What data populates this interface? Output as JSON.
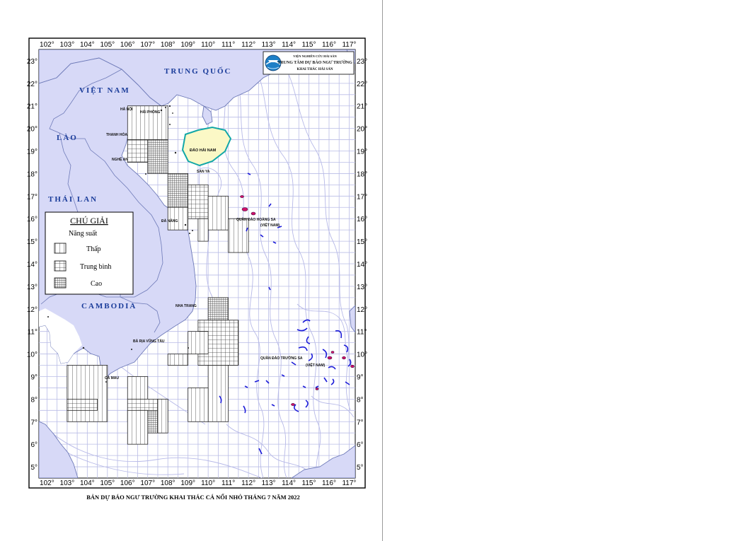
{
  "axes": {
    "lon_labels": [
      "102°",
      "103°",
      "104°",
      "105°",
      "106°",
      "107°",
      "108°",
      "109°",
      "110°",
      "111°",
      "112°",
      "113°",
      "114°",
      "115°",
      "116°",
      "117°"
    ],
    "lat_labels": [
      "23°",
      "22°",
      "21°",
      "20°",
      "19°",
      "18°",
      "17°",
      "16°",
      "15°",
      "14°",
      "13°",
      "12°",
      "11°",
      "10°",
      "9°",
      "8°",
      "7°",
      "6°",
      "5°"
    ]
  },
  "countries": {
    "china": "TRUNG QUỐC",
    "vietnam": "VIỆT NAM",
    "laos": "LÀO",
    "thailand": "THÁI LAN",
    "cambodia": "CAMBODIA"
  },
  "places": {
    "hanoi": "HÀ NỘI",
    "haiphong": "HẢI PHÒNG",
    "thanhhoa": "THANH HÓA",
    "nghean": "NGHỆ AN",
    "danang": "ĐÀ NẴNG",
    "nhatrang": "NHA TRANG",
    "bariavungtau": "BÀ RỊA VŨNG TÀU",
    "camau": "CÀ MAU",
    "hainan": "ĐẢO HẢI NAM",
    "sanya": "SAN YA",
    "paracel": "QUẦN ĐẢO HOÀNG SA",
    "paracel_country": "(VIỆT NAM)",
    "spratly": "QUẦN ĐẢO TRƯỜNG SA",
    "spratly_country": "(VIỆT NAM)"
  },
  "logo": {
    "line1": "VIỆN NGHIÊN CỨU HẢI SẢN",
    "line2": "TRUNG TÂM DỰ BÁO NGƯ TRƯỜNG",
    "line3": "KHAI THÁC HẢI SẢN"
  },
  "legend": {
    "title": "CHÚ GIẢI",
    "subtitle": "Năng suất",
    "items": [
      {
        "label": "Thấp",
        "level": "low"
      },
      {
        "label": "Trung bình",
        "level": "medium"
      },
      {
        "label": "Cao",
        "level": "high"
      }
    ]
  },
  "caption": "BẢN DỰ BÁO NGƯ TRƯỜNG KHAI THÁC CÁ NỔI NHỎ THÁNG 7 NĂM 2022",
  "colors": {
    "land": "#d7d9f7",
    "land_border": "#6e7ab8",
    "grid": "#b9bce6",
    "isobath": "#b7b9e8",
    "hainan": "#fbf8c6",
    "hainan_border": "#12a7a7",
    "country_text": "#1a3c9a",
    "reef_blue": "#1b1bd8",
    "reef_red": "#d0106a"
  },
  "forecast_cells": [
    {
      "lon": [
        106,
        108
      ],
      "lat": [
        19.5,
        21
      ],
      "level": "low"
    },
    {
      "lon": [
        106,
        107
      ],
      "lat": [
        18.5,
        19.5
      ],
      "level": "medium"
    },
    {
      "lon": [
        107,
        108
      ],
      "lat": [
        18,
        19.5
      ],
      "level": "high"
    },
    {
      "lon": [
        108,
        109
      ],
      "lat": [
        16.5,
        18
      ],
      "level": "high"
    },
    {
      "lon": [
        109,
        110
      ],
      "lat": [
        16,
        17.5
      ],
      "level": "medium"
    },
    {
      "lon": [
        110,
        111
      ],
      "lat": [
        15.5,
        17
      ],
      "level": "low"
    },
    {
      "lon": [
        111,
        112
      ],
      "lat": [
        14.5,
        16
      ],
      "level": "low"
    },
    {
      "lon": [
        108,
        109
      ],
      "lat": [
        15.5,
        16.5
      ],
      "level": "low"
    },
    {
      "lon": [
        109.5,
        110
      ],
      "lat": [
        15,
        16
      ],
      "level": "low"
    },
    {
      "lon": [
        110,
        111
      ],
      "lat": [
        11.5,
        12.5
      ],
      "level": "high"
    },
    {
      "lon": [
        109.5,
        111.5
      ],
      "lat": [
        9.5,
        11.5
      ],
      "level": "medium"
    },
    {
      "lon": [
        109,
        110
      ],
      "lat": [
        10,
        11
      ],
      "level": "low"
    },
    {
      "lon": [
        108,
        109
      ],
      "lat": [
        9.5,
        10
      ],
      "level": "low"
    },
    {
      "lon": [
        110,
        111
      ],
      "lat": [
        7,
        9.5
      ],
      "level": "low"
    },
    {
      "lon": [
        109,
        110
      ],
      "lat": [
        7,
        8.5
      ],
      "level": "low"
    },
    {
      "lon": [
        103,
        105
      ],
      "lat": [
        7,
        9.5
      ],
      "level": "low"
    },
    {
      "lon": [
        103,
        104.5
      ],
      "lat": [
        7.5,
        8
      ],
      "level": "medium"
    },
    {
      "lon": [
        106,
        107
      ],
      "lat": [
        8,
        9
      ],
      "level": "low"
    },
    {
      "lon": [
        106,
        108
      ],
      "lat": [
        7,
        8
      ],
      "level": "medium"
    },
    {
      "lon": [
        106.5,
        107.5
      ],
      "lat": [
        6.5,
        7.5
      ],
      "level": "high"
    },
    {
      "lon": [
        106,
        107
      ],
      "lat": [
        6,
        7.5
      ],
      "level": "low"
    },
    {
      "lon": [
        107.5,
        108
      ],
      "lat": [
        6.5,
        8
      ],
      "level": "low"
    }
  ]
}
